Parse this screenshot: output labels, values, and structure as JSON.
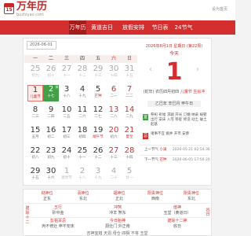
{
  "header": {
    "logo_mark": "15",
    "logo_text": "万年历",
    "logo_sub": "buzhiyao.com",
    "top_link": "设为首页"
  },
  "nav": {
    "items": [
      "万年历",
      "黄道吉日",
      "放假安排",
      "节日表",
      "24节气"
    ],
    "active": "万年历"
  },
  "calendar": {
    "date_input": "2026-06-01",
    "weekdays": [
      "一",
      "二",
      "三",
      "四",
      "五",
      "六",
      "日"
    ],
    "weekend_indexes": [
      5,
      6
    ],
    "rows": [
      [
        {
          "d": "25",
          "l": "初九",
          "dim": true
        },
        {
          "d": "26",
          "l": "初十",
          "dim": true
        },
        {
          "d": "27",
          "l": "十一",
          "dim": true
        },
        {
          "d": "28",
          "l": "十二",
          "dim": true
        },
        {
          "d": "29",
          "l": "十三",
          "dim": true
        },
        {
          "d": "30",
          "l": "十四",
          "dim": true
        },
        {
          "d": "31",
          "l": "十五",
          "dim": true
        }
      ],
      [
        {
          "d": "1",
          "l": "儿童节",
          "sel": true,
          "fest": true
        },
        {
          "d": "2",
          "l": "十七",
          "tag": "休",
          "today": true
        },
        {
          "d": "3",
          "l": "十八"
        },
        {
          "d": "4",
          "l": "十九"
        },
        {
          "d": "5",
          "l": "芒种",
          "fest": true
        },
        {
          "d": "6",
          "l": "二一"
        },
        {
          "d": "7",
          "l": "二二"
        }
      ],
      [
        {
          "d": "8",
          "l": "二三"
        },
        {
          "d": "9",
          "l": "二四"
        },
        {
          "d": "10",
          "l": "二五"
        },
        {
          "d": "11",
          "l": "二六"
        },
        {
          "d": "12",
          "l": "二七"
        },
        {
          "d": "13",
          "l": "二八"
        },
        {
          "d": "14",
          "l": "二九"
        }
      ],
      [
        {
          "d": "15",
          "l": "五月"
        },
        {
          "d": "16",
          "l": "初二"
        },
        {
          "d": "17",
          "l": "初三"
        },
        {
          "d": "18",
          "l": "初四"
        },
        {
          "d": "19",
          "l": "端午节",
          "fest": true
        },
        {
          "d": "20",
          "l": "初六"
        },
        {
          "d": "21",
          "l": "夏至",
          "fest": true
        }
      ],
      [
        {
          "d": "22",
          "l": "初八"
        },
        {
          "d": "23",
          "l": "初九"
        },
        {
          "d": "24",
          "l": "初十"
        },
        {
          "d": "25",
          "l": "十一"
        },
        {
          "d": "26",
          "l": "十二"
        },
        {
          "d": "27",
          "l": "十三"
        },
        {
          "d": "28",
          "l": "十四"
        }
      ],
      [
        {
          "d": "29",
          "l": "十五"
        },
        {
          "d": "30",
          "l": "十六"
        },
        {
          "d": "1",
          "l": "建党节",
          "dim": true
        },
        {
          "d": "2",
          "l": "十八",
          "dim": true
        },
        {
          "d": "3",
          "l": "十九",
          "dim": true
        },
        {
          "d": "4",
          "l": "二十",
          "dim": true
        },
        {
          "d": "5",
          "l": "廿一",
          "dim": true
        }
      ]
    ]
  },
  "side": {
    "date_line": "2026年6月1日 星期日 (第22周)",
    "today_label": "今天",
    "big_day": "1",
    "prev_arrow": "‹",
    "next_arrow": "›",
    "lunar": "(蛇年) 农历四月初四",
    "lunar_tag": "儿童节 生肖冲",
    "ganzhi": "乙巳年 辛巳月 甲午日",
    "yi_label": "宜",
    "yi_text": "祭祀 祈福 求嗣 开光 订婚 纳采 嫁娶 出行 安床 入宅 移徙 修造 动土 破土 起基",
    "ji_label": "忌",
    "ji_text": "诸事不宜 掘井 开市 安葬",
    "prev_term_label": "上一节气",
    "prev_term_name": "小满",
    "prev_term_time": "2026-05-21 02:54:36",
    "next_term_label": "下一节气",
    "next_term_name": "芒种",
    "next_term_time": "2026-06-05 17:56:20"
  },
  "info": {
    "row1": [
      {
        "h": "财神位",
        "v": "正东"
      },
      {
        "h": "喜神位",
        "v": "东北"
      },
      {
        "h": "福神位",
        "v": "正北"
      },
      {
        "h": "阳贵神位",
        "v": "西南"
      },
      {
        "h": "阴贵神位",
        "v": "东北"
      }
    ],
    "row2": [
      {
        "h": "五行",
        "v": "砂中金"
      },
      {
        "h": "冲煞",
        "v": "冲羊 煞东"
      },
      {
        "h": "值神",
        "v": "玉堂（黄道日）"
      }
    ],
    "row3": [
      {
        "h": "彭祖百忌",
        "v": "丙不修灶 申不安床"
      },
      {
        "h": "今日胎神",
        "v": "厨灶门 外正南"
      },
      {
        "h": "建除十二神",
        "v": "收日"
      }
    ],
    "left_tab": "建除十二",
    "right_tab": "凶日",
    "footer": "吉神宜趋 天恩 母仓 四相 不将 玉堂"
  }
}
